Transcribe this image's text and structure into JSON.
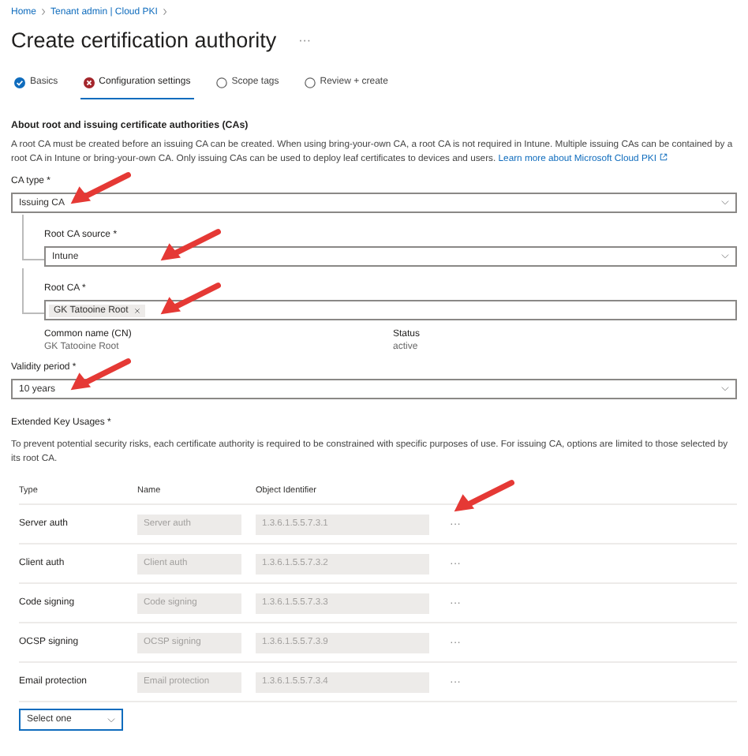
{
  "breadcrumb": [
    "Home",
    "Tenant admin | Cloud PKI"
  ],
  "title": "Create certification authority",
  "title_more": "···",
  "tabs": [
    {
      "label": "Basics",
      "kind": "done",
      "selected": false
    },
    {
      "label": "Configuration settings",
      "kind": "error",
      "selected": true
    },
    {
      "label": "Scope tags",
      "kind": "pending",
      "selected": false
    },
    {
      "label": "Review + create",
      "kind": "pending",
      "selected": false
    }
  ],
  "about": {
    "heading": "About root and issuing certificate authorities (CAs)",
    "text": "A root CA must be created before an issuing CA can be created. When using bring-your-own CA, a root CA is not required in Intune. Multiple issuing CAs can be contained by a root CA in Intune or bring-your-own CA. Only issuing CAs can be used to deploy leaf certificates to devices and users.",
    "link": "Learn more about Microsoft Cloud PKI"
  },
  "ca_type": {
    "label": "CA type *",
    "value": "Issuing CA",
    "kind": "dropdown",
    "arrow": true,
    "children": [
      {
        "label": "Root CA source *",
        "value": "Intune",
        "kind": "dropdown",
        "arrow": true
      },
      {
        "label": "Root CA *",
        "value": "GK Tatooine Root",
        "kind": "tag",
        "arrow": true
      }
    ]
  },
  "root_ca_details": [
    {
      "label": "Common name (CN)",
      "value": "GK Tatooine Root"
    },
    {
      "label": "Status",
      "value": "active"
    }
  ],
  "validity": {
    "label": "Validity period *",
    "value": "10 years",
    "kind": "dropdown",
    "arrow": true
  },
  "eku": {
    "heading": "Extended Key Usages *",
    "text": "To prevent potential security risks, each certificate authority is required to be constrained with specific purposes of use. For issuing CA, options are limited to those selected by its root CA.",
    "columns": [
      "Type",
      "Name",
      "Object Identifier"
    ],
    "rows": [
      {
        "type": "Server auth",
        "name": "Server auth",
        "oid": "1.3.6.1.5.5.7.3.1",
        "more": "···",
        "arrow": true
      },
      {
        "type": "Client auth",
        "name": "Client auth",
        "oid": "1.3.6.1.5.5.7.3.2",
        "more": "···"
      },
      {
        "type": "Code signing",
        "name": "Code signing",
        "oid": "1.3.6.1.5.5.7.3.3",
        "more": "···"
      },
      {
        "type": "OCSP signing",
        "name": "OCSP signing",
        "oid": "1.3.6.1.5.5.7.3.9",
        "more": "···"
      },
      {
        "type": "Email protection",
        "name": "Email protection",
        "oid": "1.3.6.1.5.5.7.3.4",
        "more": "···"
      }
    ],
    "select": {
      "value": "Select one"
    }
  }
}
